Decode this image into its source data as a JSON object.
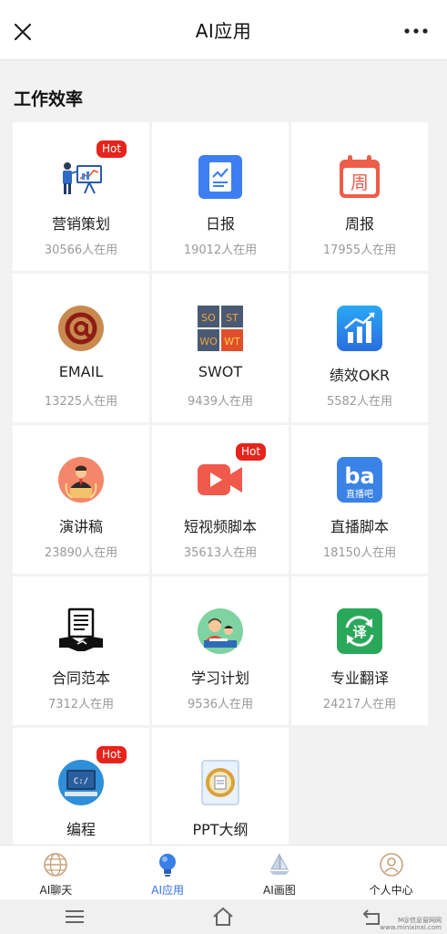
{
  "header": {
    "title": "AI应用"
  },
  "section": {
    "title": "工作效率"
  },
  "hot_label": "Hot",
  "cards": [
    {
      "name": "营销策划",
      "uses": "30566人在用",
      "icon": "presentation-icon",
      "hot": true
    },
    {
      "name": "日报",
      "uses": "19012人在用",
      "icon": "daily-report-icon",
      "hot": false
    },
    {
      "name": "周报",
      "uses": "17955人在用",
      "icon": "weekly-calendar-icon",
      "hot": false
    },
    {
      "name": "EMAIL",
      "uses": "13225人在用",
      "icon": "at-sign-icon",
      "hot": false
    },
    {
      "name": "SWOT",
      "uses": "9439人在用",
      "icon": "swot-grid-icon",
      "hot": false
    },
    {
      "name": "绩效OKR",
      "uses": "5582人在用",
      "icon": "bar-growth-icon",
      "hot": false
    },
    {
      "name": "演讲稿",
      "uses": "23890人在用",
      "icon": "speaker-icon",
      "hot": false
    },
    {
      "name": "短视频脚本",
      "uses": "35613人在用",
      "icon": "video-camera-icon",
      "hot": true
    },
    {
      "name": "直播脚本",
      "uses": "18150人在用",
      "icon": "live-stream-icon",
      "hot": false
    },
    {
      "name": "合同范本",
      "uses": "7312人在用",
      "icon": "contract-handshake-icon",
      "hot": false
    },
    {
      "name": "学习计划",
      "uses": "9536人在用",
      "icon": "study-icon",
      "hot": false
    },
    {
      "name": "专业翻译",
      "uses": "24217人在用",
      "icon": "translate-icon",
      "hot": false
    },
    {
      "name": "编程",
      "uses": "",
      "icon": "code-monitor-icon",
      "hot": true
    },
    {
      "name": "PPT大纲",
      "uses": "",
      "icon": "ppt-document-icon",
      "hot": false
    }
  ],
  "swot_letters": [
    "SO",
    "ST",
    "WO",
    "WT"
  ],
  "translate_char": "译",
  "weekly_char": "周",
  "live_text": "直播吧",
  "code_text": "C:/",
  "tabs": [
    {
      "label": "AI聊天",
      "icon": "globe-icon",
      "active": false
    },
    {
      "label": "AI应用",
      "icon": "lightbulb-icon",
      "active": true
    },
    {
      "label": "AI画图",
      "icon": "sailboat-icon",
      "active": false
    },
    {
      "label": "个人中心",
      "icon": "user-circle-icon",
      "active": false
    }
  ],
  "watermark": [
    "M@信息窗网网",
    "www.minixinxi.com"
  ],
  "colors": {
    "accent": "#2f6ee6",
    "hot": "#e5241b"
  }
}
